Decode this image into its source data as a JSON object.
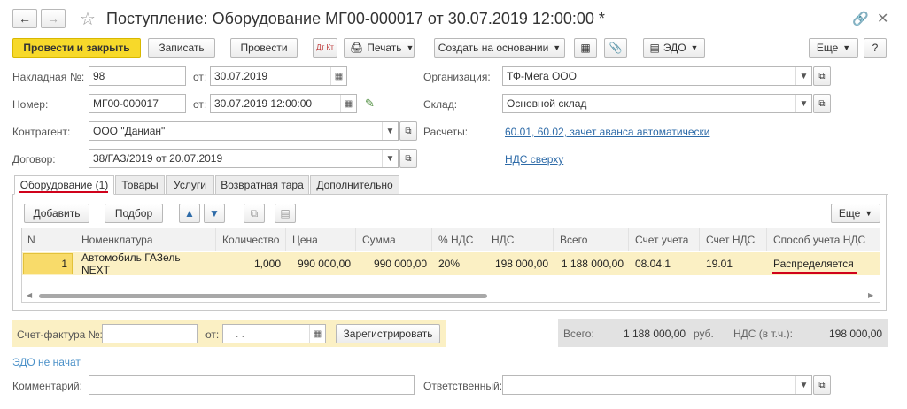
{
  "window": {
    "title": "Поступление: Оборудование МГ00-000017 от 30.07.2019 12:00:00 *"
  },
  "toolbar": {
    "post_close": "Провести и закрыть",
    "save": "Записать",
    "post": "Провести",
    "dtkt": "Дт Кт",
    "print": "Печать",
    "create_based": "Создать на основании",
    "edo": "ЭДО",
    "more": "Еще",
    "help": "?"
  },
  "header": {
    "invoice_label": "Накладная",
    "invoice_no_label": "№:",
    "invoice_no": "98",
    "invoice_from_label": "от:",
    "invoice_date": "30.07.2019",
    "number_label": "Номер:",
    "number": "МГ00-000017",
    "number_from_label": "от:",
    "number_date": "30.07.2019 12:00:00",
    "org_label": "Организация:",
    "org": "ТФ-Мега ООО",
    "warehouse_label": "Склад:",
    "warehouse": "Основной склад",
    "counterparty_label": "Контрагент:",
    "counterparty": "ООО \"Даниан\"",
    "settlements_label": "Расчеты:",
    "settlements_link": "60.01, 60.02, зачет аванса автоматически",
    "contract_label": "Договор:",
    "contract": "38/ГАЗ/2019 от 20.07.2019",
    "vat_link": "НДС сверху"
  },
  "tabs": [
    {
      "label": "Оборудование (1)"
    },
    {
      "label": "Товары"
    },
    {
      "label": "Услуги"
    },
    {
      "label": "Возвратная тара"
    },
    {
      "label": "Дополнительно"
    }
  ],
  "table_toolbar": {
    "add": "Добавить",
    "pick": "Подбор",
    "more": "Еще"
  },
  "table": {
    "columns": [
      "N",
      "Номенклатура",
      "Количество",
      "Цена",
      "Сумма",
      "% НДС",
      "НДС",
      "Всего",
      "Счет учета",
      "Счет НДС",
      "Способ учета НДС"
    ],
    "rows": [
      [
        "1",
        "Автомобиль ГАЗель NEXT",
        "1,000",
        "990 000,00",
        "990 000,00",
        "20%",
        "198 000,00",
        "1 188 000,00",
        "08.04.1",
        "19.01",
        "Распределяется"
      ]
    ]
  },
  "footer": {
    "invoice_label": "Счет-фактура №:",
    "invoice_from_label": "от:",
    "invoice_date_placeholder": ". .",
    "register": "Зарегистрировать",
    "total_label": "Всего:",
    "total": "1 188 000,00",
    "currency": "руб.",
    "vat_label": "НДС (в т.ч.):",
    "vat": "198 000,00",
    "edo_status": "ЭДО не начат",
    "comment_label": "Комментарий:",
    "responsible_label": "Ответственный:"
  },
  "colors": {
    "accent_yellow": "#f7d92a",
    "highlight_row": "#fbf0c4",
    "red_underline": "#d0021b",
    "link_blue": "#2e6ba8"
  }
}
